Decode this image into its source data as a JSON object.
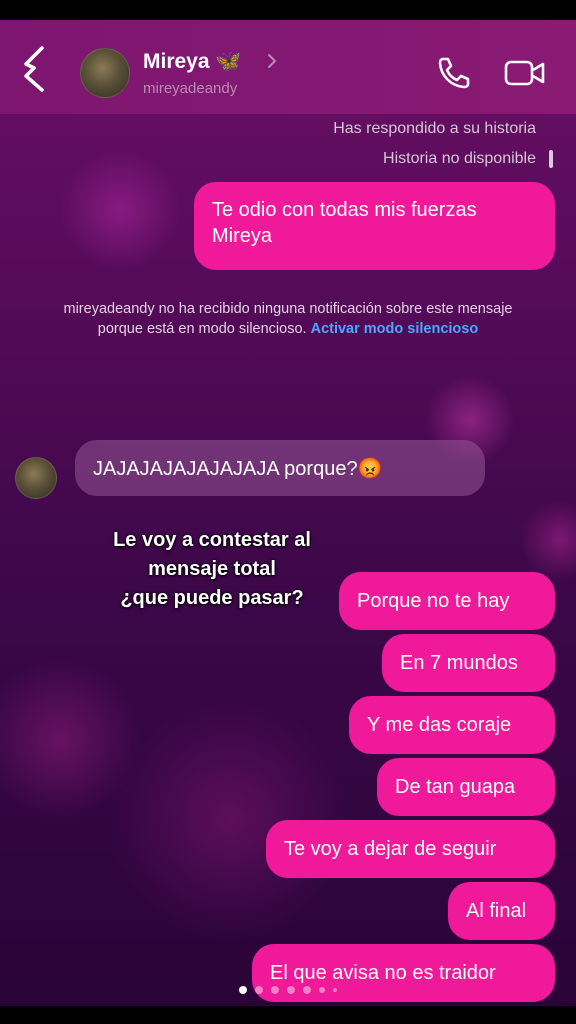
{
  "header": {
    "contact_name": "Mireya",
    "contact_emoji": "🦋",
    "username": "mireyadeandy"
  },
  "meta": {
    "replied_story": "Has respondido a su historia",
    "story_unavailable": "Historia no disponible"
  },
  "messages": {
    "m1": "Te odio con todas mis fuerzas Mireya",
    "incoming": "JAJAJAJAJAJAJAJA porque?😡",
    "o1": "Porque no te hay",
    "o2": "En 7 mundos",
    "o3": "Y me das coraje",
    "o4": "De tan guapa",
    "o5": "Te voy a dejar de seguir",
    "o6": "Al final",
    "o7": "El que avisa no es traidor"
  },
  "notice": {
    "text": "mireyadeandy no ha recibido ninguna notificación sobre este mensaje porque está en modo silencioso.",
    "link": "Activar modo silencioso"
  },
  "overlay": {
    "caption": "Le voy a contestar al\nmensaje total\n¿que puede pasar?"
  },
  "carousel": {
    "active_index": 0,
    "dot_count": 7
  },
  "colors": {
    "header_bg": "#7d1670",
    "outgoing_bubble": "#f0199a",
    "link": "#4aa8ff"
  },
  "icons": [
    "back-arrow-icon",
    "chevron-right-icon",
    "phone-icon",
    "video-camera-icon"
  ]
}
